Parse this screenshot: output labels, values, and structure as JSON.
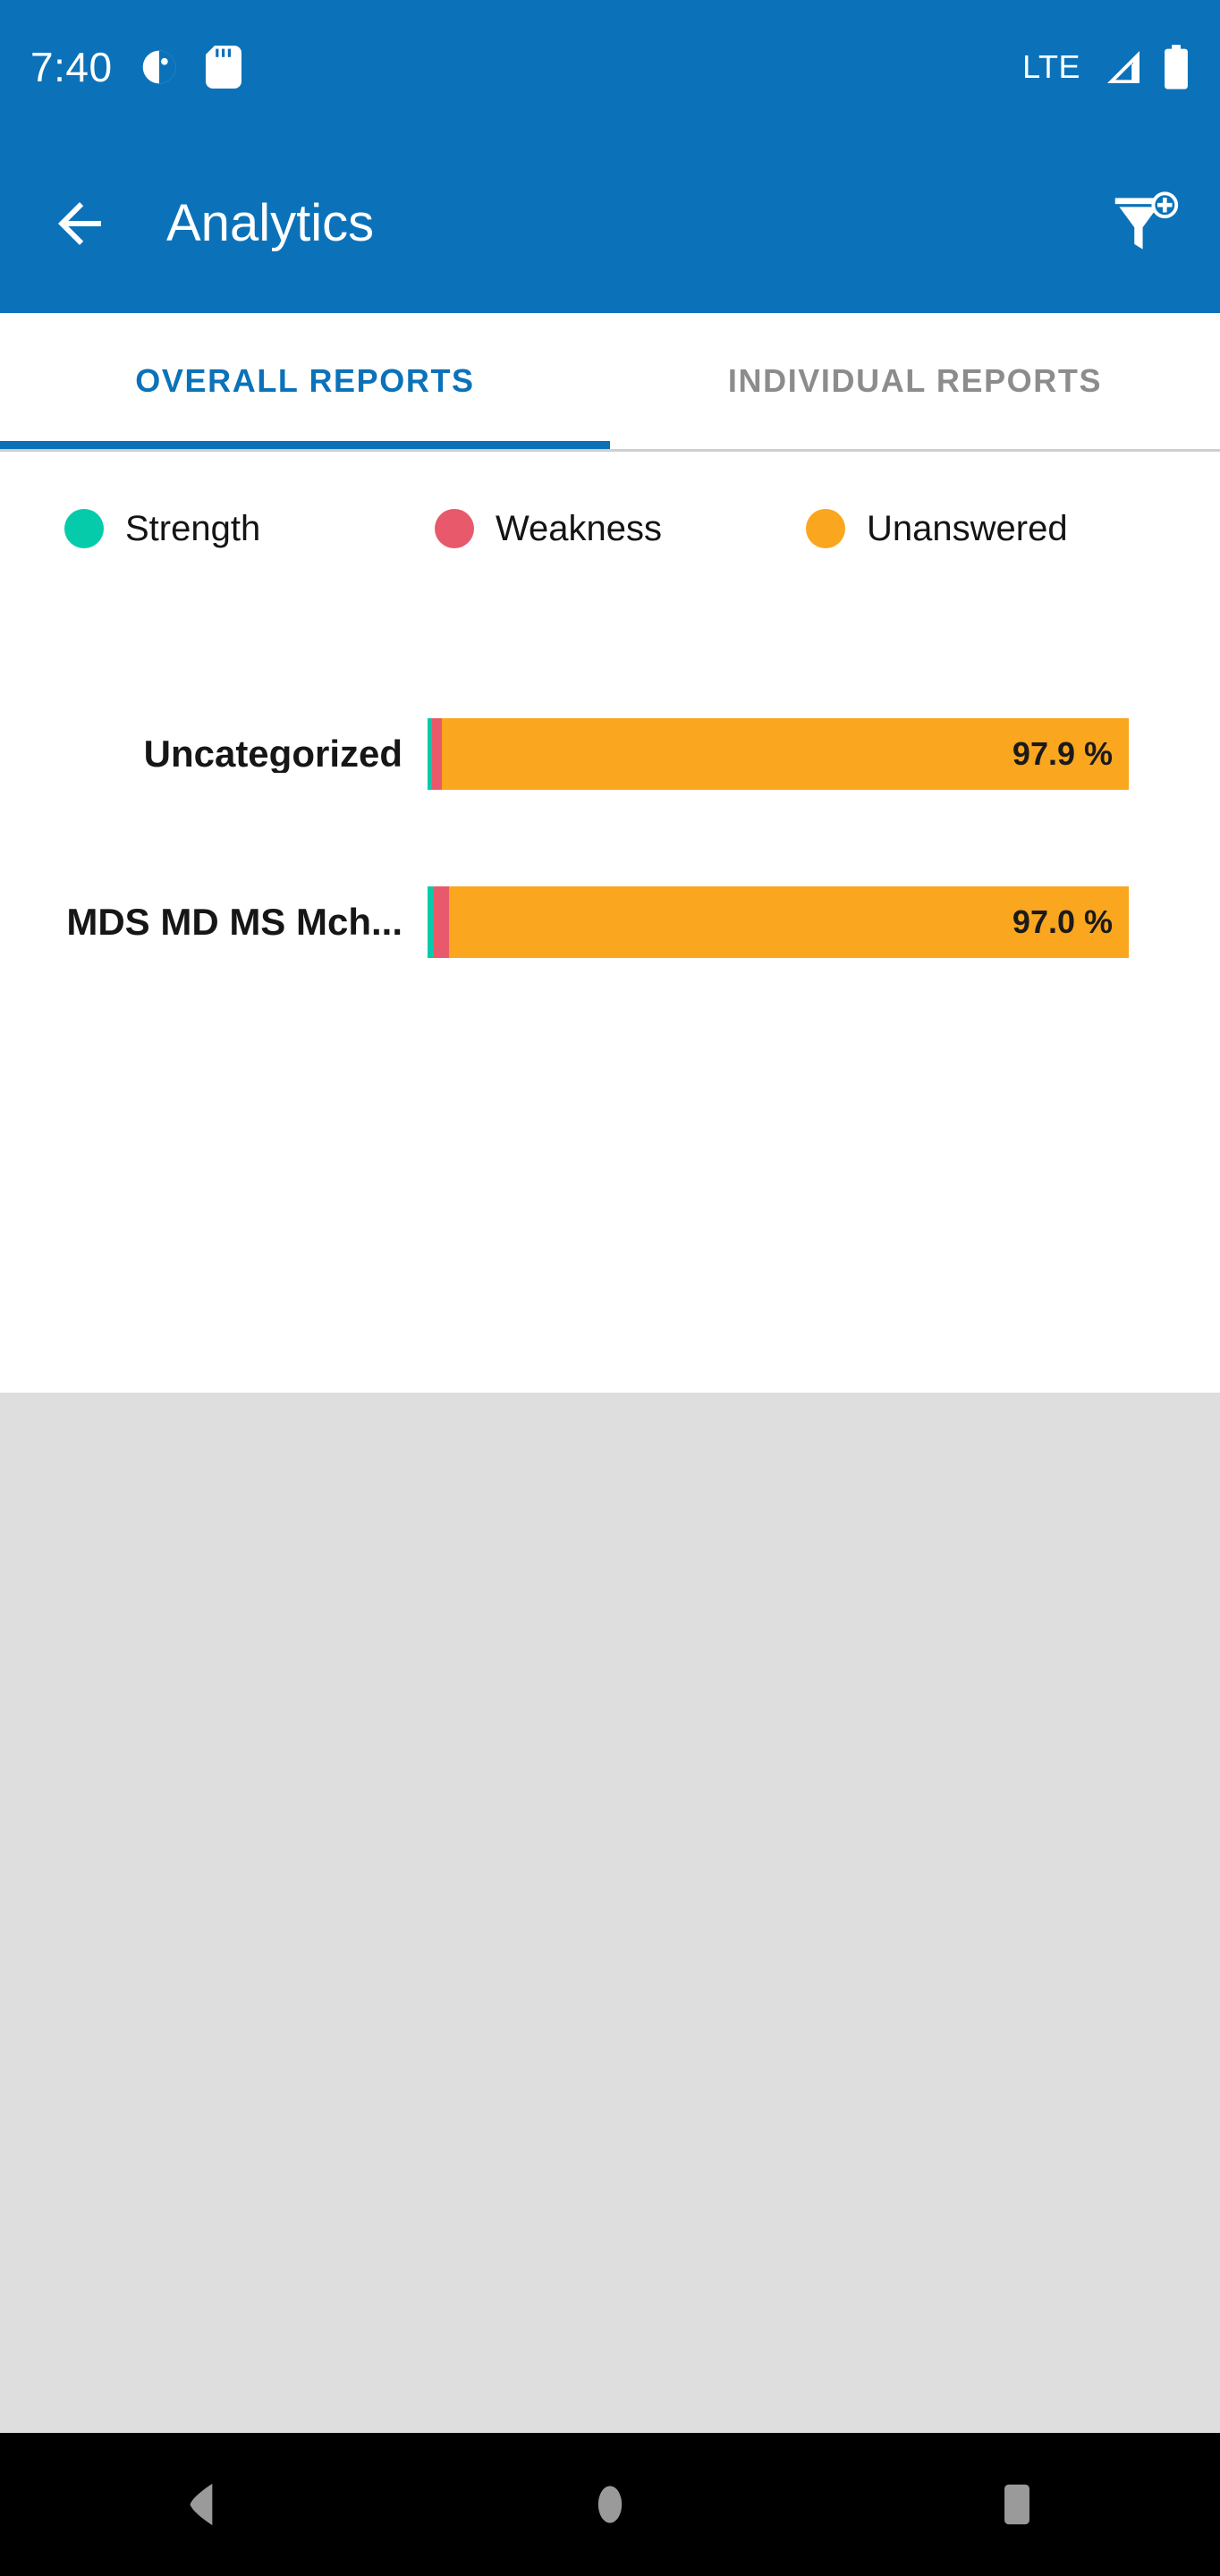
{
  "status_bar": {
    "time": "7:40",
    "network_label": "LTE",
    "icons": [
      "do-not-disturb-icon",
      "sd-card-icon",
      "signal-icon",
      "battery-icon"
    ],
    "background_color": "#0b72b9"
  },
  "app_bar": {
    "title": "Analytics",
    "back_icon": "arrow-left-icon",
    "action_icon": "filter-add-icon",
    "background_color": "#0b72b9"
  },
  "tabs": [
    {
      "label": "OVERALL REPORTS",
      "active": true
    },
    {
      "label": "INDIVIDUAL REPORTS",
      "active": false
    }
  ],
  "legend": [
    {
      "label": "Strength",
      "color": "#06cbab"
    },
    {
      "label": "Weakness",
      "color": "#e8596b"
    },
    {
      "label": "Unanswered",
      "color": "#faa61e"
    }
  ],
  "colors": {
    "primary": "#0b72b9",
    "strength": "#06cbab",
    "weakness": "#e8596b",
    "unanswered": "#faa61e",
    "tab_active": "#0b72b9",
    "tab_inactive": "#8c8c8c",
    "empty_area": "#dedede",
    "nav_bar": "#000000"
  },
  "nav_bar": {
    "back": "triangle-back-icon",
    "home": "circle-home-icon",
    "recents": "square-recents-icon"
  },
  "chart_data": {
    "type": "bar",
    "title": "",
    "subtitle": "",
    "xlabel": "",
    "ylabel": "",
    "orientation": "horizontal",
    "stacked": true,
    "grid": false,
    "legend_position": "top-left",
    "xlim": [
      0,
      100
    ],
    "categories": [
      "Uncategorized",
      "MDS MD MS Mch..."
    ],
    "series": [
      {
        "name": "Strength",
        "color": "#06cbab",
        "values": [
          0.7,
          0.9
        ]
      },
      {
        "name": "Weakness",
        "color": "#e8596b",
        "values": [
          1.4,
          2.1
        ]
      },
      {
        "name": "Unanswered",
        "color": "#faa61e",
        "values": [
          97.9,
          97.0
        ]
      }
    ],
    "rows": [
      {
        "label": "Uncategorized",
        "value_label": "97.9 %",
        "segments": [
          {
            "name": "Strength",
            "percent": 0.7,
            "color": "#06cbab"
          },
          {
            "name": "Weakness",
            "percent": 1.4,
            "color": "#e8596b"
          },
          {
            "name": "Unanswered",
            "percent": 97.9,
            "color": "#faa61e"
          }
        ]
      },
      {
        "label": "MDS MD MS Mch...",
        "value_label": "97.0 %",
        "segments": [
          {
            "name": "Strength",
            "percent": 0.9,
            "color": "#06cbab"
          },
          {
            "name": "Weakness",
            "percent": 2.1,
            "color": "#e8596b"
          },
          {
            "name": "Unanswered",
            "percent": 97.0,
            "color": "#faa61e"
          }
        ]
      }
    ]
  }
}
